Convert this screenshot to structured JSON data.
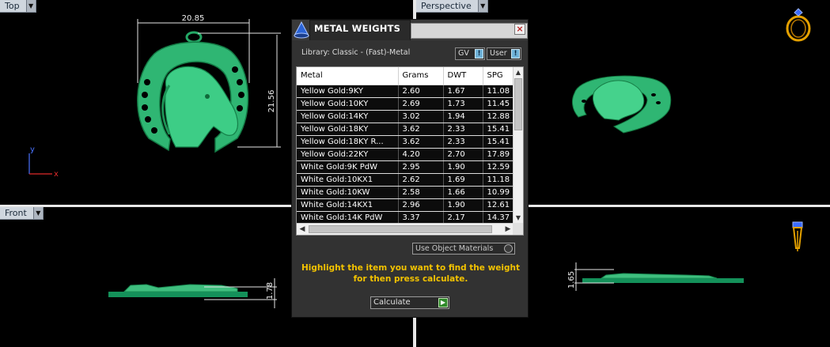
{
  "viewports": {
    "top": {
      "label": "Top"
    },
    "perspective": {
      "label": "Perspective"
    },
    "front": {
      "label": "Front"
    }
  },
  "dimensions": {
    "width": "20.85",
    "height": "21.56",
    "front_thickness": "1.78",
    "right_thickness": "1.65"
  },
  "axes": {
    "y": "y",
    "x": "x"
  },
  "dialog": {
    "title": "METAL WEIGHTS",
    "close": "×",
    "library_label": "Library: Classic - (Fast)-Metal",
    "gv_chip": "GV",
    "user_chip": "User",
    "chip_toggle": "!",
    "columns": [
      "Metal",
      "Grams",
      "DWT",
      "SPG"
    ],
    "rows": [
      [
        "Yellow Gold:9KY",
        "2.60",
        "1.67",
        "11.08"
      ],
      [
        "Yellow Gold:10KY",
        "2.69",
        "1.73",
        "11.45"
      ],
      [
        "Yellow Gold:14KY",
        "3.02",
        "1.94",
        "12.88"
      ],
      [
        "Yellow Gold:18KY",
        "3.62",
        "2.33",
        "15.41"
      ],
      [
        "Yellow Gold:18KY R...",
        "3.62",
        "2.33",
        "15.41"
      ],
      [
        "Yellow Gold:22KY",
        "4.20",
        "2.70",
        "17.89"
      ],
      [
        "White Gold:9K PdW",
        "2.95",
        "1.90",
        "12.59"
      ],
      [
        "White Gold:10KX1",
        "2.62",
        "1.69",
        "11.18"
      ],
      [
        "White Gold:10KW",
        "2.58",
        "1.66",
        "10.99"
      ],
      [
        "White Gold:14KX1",
        "2.96",
        "1.90",
        "12.61"
      ],
      [
        "White Gold:14K PdW",
        "3.37",
        "2.17",
        "14.37"
      ]
    ],
    "use_object_materials": "Use Object Materials",
    "hint": "Highlight the item you want to find the weight for then press calculate.",
    "calculate_label": "Calculate",
    "calculate_icon": "▶"
  },
  "colors": {
    "model_green": "#3fbf7f",
    "model_dark_green": "#128a4c",
    "hint_yellow": "#f2c200",
    "ring_gold": "#e5a100"
  }
}
